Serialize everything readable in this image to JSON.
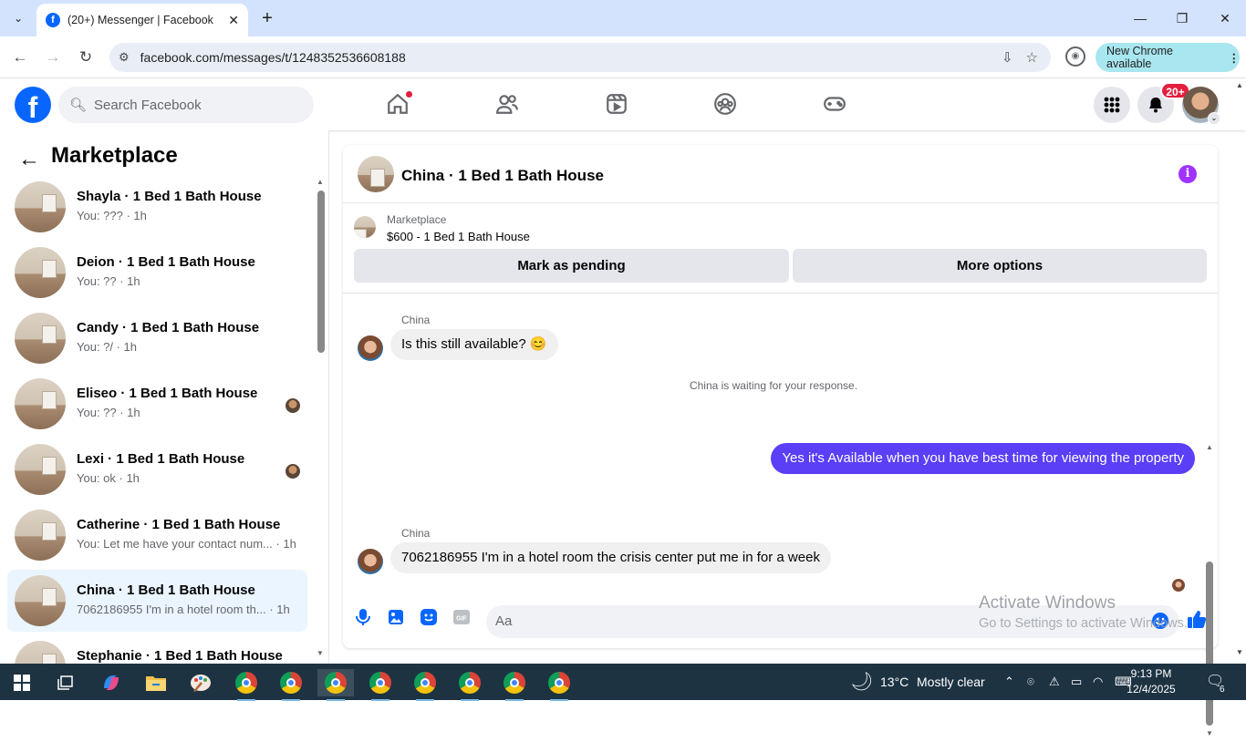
{
  "browser": {
    "tab_title": "(20+) Messenger | Facebook",
    "url": "facebook.com/messages/t/1248352536608188",
    "new_chrome_label": "New Chrome available"
  },
  "header": {
    "search_placeholder": "Search Facebook",
    "notification_badge": "20+"
  },
  "sidebar": {
    "title": "Marketplace",
    "conversations": [
      {
        "name": "Shayla · 1 Bed 1 Bath House",
        "preview": "You: ??? · 1h"
      },
      {
        "name": "Deion · 1 Bed 1 Bath House",
        "preview": "You: ?? · 1h"
      },
      {
        "name": "Candy · 1 Bed 1 Bath House",
        "preview": "You: ?/ · 1h"
      },
      {
        "name": "Eliseo · 1 Bed 1 Bath House",
        "preview": "You: ?? · 1h"
      },
      {
        "name": "Lexi · 1 Bed 1 Bath House",
        "preview": "You: ok · 1h"
      },
      {
        "name": "Catherine · 1 Bed 1 Bath House",
        "preview": "You: Let me have your contact num... · 1h"
      },
      {
        "name": "China · 1 Bed 1 Bath House",
        "preview": "7062186955 I'm in a hotel room th... · 1h"
      },
      {
        "name": "Stephanie · 1 Bed 1 Bath House",
        "preview": ""
      }
    ]
  },
  "chat": {
    "title": "China · 1 Bed 1 Bath House",
    "listing_source": "Marketplace",
    "listing": "$600 - 1 Bed 1 Bath House",
    "mark_pending": "Mark as pending",
    "more_options": "More options",
    "messages": [
      {
        "sender": "China",
        "text": "Is this still available? 😊"
      },
      {
        "system": "China is waiting for your response."
      },
      {
        "sender": "You",
        "text": "Yes it's Available when you have best time for viewing the property"
      },
      {
        "sender": "China",
        "text": "7062186955 I'm in a hotel room the crisis center put me in for a week"
      }
    ],
    "input_placeholder": "Aa"
  },
  "watermark": {
    "line1": "Activate Windows",
    "line2": "Go to Settings to activate Windows."
  },
  "taskbar": {
    "weather_temp": "13°C",
    "weather_text": "Mostly clear",
    "time": "9:13 PM",
    "date": "12/4/2025",
    "notif_count": "6"
  },
  "colors": {
    "facebook_blue": "#0866ff",
    "outgoing_bubble": "#5a3ff7",
    "badge_red": "#e41e3f",
    "info_purple": "#a033ff"
  }
}
